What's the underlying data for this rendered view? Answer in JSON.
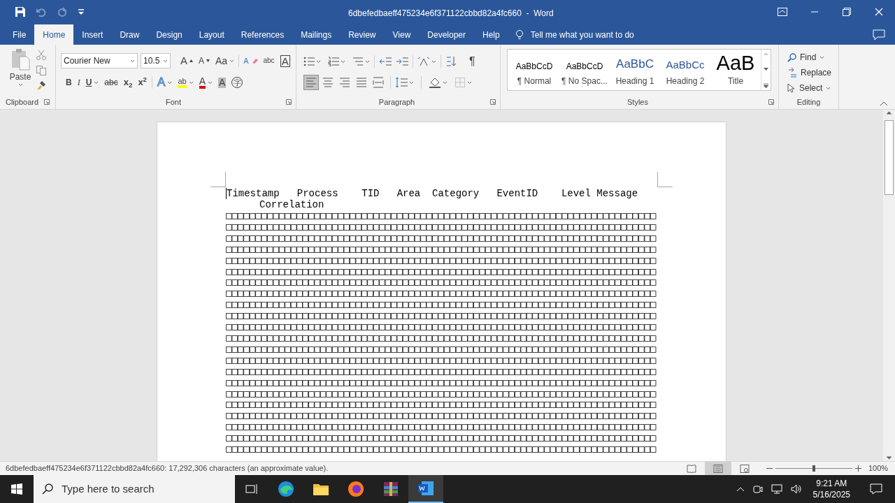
{
  "window": {
    "title": "6dbefedbaeff475234e6f371122cbbd82a4fc660  -  Word"
  },
  "tabs": [
    {
      "label": "File",
      "selected": false
    },
    {
      "label": "Home",
      "selected": true
    },
    {
      "label": "Insert",
      "selected": false
    },
    {
      "label": "Draw",
      "selected": false
    },
    {
      "label": "Design",
      "selected": false
    },
    {
      "label": "Layout",
      "selected": false
    },
    {
      "label": "References",
      "selected": false
    },
    {
      "label": "Mailings",
      "selected": false
    },
    {
      "label": "Review",
      "selected": false
    },
    {
      "label": "View",
      "selected": false
    },
    {
      "label": "Developer",
      "selected": false
    },
    {
      "label": "Help",
      "selected": false
    }
  ],
  "tell_me": {
    "placeholder": "Tell me what you want to do"
  },
  "ribbon": {
    "clipboard": {
      "paste": "Paste",
      "label": "Clipboard"
    },
    "font": {
      "name": "Courier New",
      "size": "10.5",
      "label": "Font",
      "row_1": [
        {
          "kind": "grow",
          "label": "A"
        },
        {
          "kind": "shrink",
          "label": "A"
        },
        {
          "kind": "case",
          "label": "Aa"
        },
        {
          "kind": "clear",
          "label": "A"
        },
        {
          "kind": "phonetic",
          "label": "abc"
        },
        {
          "kind": "border",
          "label": "A"
        }
      ],
      "row_2": [
        {
          "kind": "bold",
          "label": "B"
        },
        {
          "kind": "italic",
          "label": "I"
        },
        {
          "kind": "underline",
          "label": "U"
        },
        {
          "kind": "strike",
          "label": "abc"
        },
        {
          "kind": "sub",
          "label": "x$_{2}$"
        },
        {
          "kind": "sup",
          "label": "x$^{2}$"
        },
        {
          "kind": "effects",
          "label": "A"
        },
        {
          "kind": "highlight",
          "label": "ab"
        },
        {
          "kind": "color",
          "label": "A"
        },
        {
          "kind": "shading",
          "label": "A"
        },
        {
          "kind": "enclose",
          "label": "字"
        }
      ]
    },
    "paragraph": {
      "label": "Paragraph",
      "marks": "¶",
      "alignments": [
        {
          "selected": true
        },
        {
          "selected": false
        },
        {
          "selected": false
        },
        {
          "selected": false
        },
        {
          "selected": false
        }
      ]
    },
    "styles": {
      "label": "Styles",
      "items": [
        {
          "preview": "AaBbCcD",
          "name": "¶ Normal",
          "kind": "body",
          "selected": false
        },
        {
          "preview": "AaBbCcD",
          "name": "¶ No Spac...",
          "kind": "body",
          "selected": false
        },
        {
          "preview": "AaBbC",
          "name": "Heading 1",
          "kind": "heading1",
          "selected": false
        },
        {
          "preview": "AaBbCc",
          "name": "Heading 2",
          "kind": "heading2",
          "selected": false
        },
        {
          "preview": "AaB",
          "name": "Title",
          "kind": "title",
          "selected": false
        }
      ]
    },
    "editing": {
      "label": "Editing",
      "items": [
        {
          "kind": "find",
          "label": "Find"
        },
        {
          "kind": "replace",
          "label": "Replace"
        },
        {
          "kind": "select",
          "label": "Select"
        }
      ]
    }
  },
  "document": {
    "header_lines": [
      "Timestamp   Process    TID   Area  Category   EventID    Level Message",
      "Correlation"
    ],
    "rows": [
      "□□□□□□□□□□□□□□□□□□□□□□□□□□□□□□□□□□□□□□□□□□□□□□□□□□□□□□□□□□□□□□□□□□□□□□□□□",
      "□□□□□□□□□□□□□□□□□□□□□□□□□□□□□□□□□□□□□□□□□□□□□□□□□□□□□□□□□□□□□□□□□□□□□□□□□",
      "□□□□□□□□□□□□□□□□□□□□□□□□□□□□□□□□□□□□□□□□□□□□□□□□□□□□□□□□□□□□□□□□□□□□□□□□□",
      "□□□□□□□□□□□□□□□□□□□□□□□□□□□□□□□□□□□□□□□□□□□□□□□□□□□□□□□□□□□□□□□□□□□□□□□□□",
      "□□□□□□□□□□□□□□□□□□□□□□□□□□□□□□□□□□□□□□□□□□□□□□□□□□□□□□□□□□□□□□□□□□□□□□□□□",
      "□□□□□□□□□□□□□□□□□□□□□□□□□□□□□□□□□□□□□□□□□□□□□□□□□□□□□□□□□□□□□□□□□□□□□□□□□",
      "□□□□□□□□□□□□□□□□□□□□□□□□□□□□□□□□□□□□□□□□□□□□□□□□□□□□□□□□□□□□□□□□□□□□□□□□□",
      "□□□□□□□□□□□□□□□□□□□□□□□□□□□□□□□□□□□□□□□□□□□□□□□□□□□□□□□□□□□□□□□□□□□□□□□□□",
      "□□□□□□□□□□□□□□□□□□□□□□□□□□□□□□□□□□□□□□□□□□□□□□□□□□□□□□□□□□□□□□□□□□□□□□□□□",
      "□□□□□□□□□□□□□□□□□□□□□□□□□□□□□□□□□□□□□□□□□□□□□□□□□□□□□□□□□□□□□□□□□□□□□□□□□",
      "□□□□□□□□□□□□□□□□□□□□□□□□□□□□□□□□□□□□□□□□□□□□□□□□□□□□□□□□□□□□□□□□□□□□□□□□□",
      "□□□□□□□□□□□□□□□□□□□□□□□□□□□□□□□□□□□□□□□□□□□□□□□□□□□□□□□□□□□□□□□□□□□□□□□□□",
      "□□□□□□□□□□□□□□□□□□□□□□□□□□□□□□□□□□□□□□□□□□□□□□□□□□□□□□□□□□□□□□□□□□□□□□□□□",
      "□□□□□□□□□□□□□□□□□□□□□□□□□□□□□□□□□□□□□□□□□□□□□□□□□□□□□□□□□□□□□□□□□□□□□□□□□",
      "□□□□□□□□□□□□□□□□□□□□□□□□□□□□□□□□□□□□□□□□□□□□□□□□□□□□□□□□□□□□□□□□□□□□□□□□□",
      "□□□□□□□□□□□□□□□□□□□□□□□□□□□□□□□□□□□□□□□□□□□□□□□□□□□□□□□□□□□□□□□□□□□□□□□□□",
      "□□□□□□□□□□□□□□□□□□□□□□□□□□□□□□□□□□□□□□□□□□□□□□□□□□□□□□□□□□□□□□□□□□□□□□□□□",
      "□□□□□□□□□□□□□□□□□□□□□□□□□□□□□□□□□□□□□□□□□□□□□□□□□□□□□□□□□□□□□□□□□□□□□□□□□",
      "□□□□□□□□□□□□□□□□□□□□□□□□□□□□□□□□□□□□□□□□□□□□□□□□□□□□□□□□□□□□□□□□□□□□□□□□□",
      "□□□□□□□□□□□□□□□□□□□□□□□□□□□□□□□□□□□□□□□□□□□□□□□□□□□□□□□□□□□□□□□□□□□□□□□□□",
      "□□□□□□□□□□□□□□□□□□□□□□□□□□□□□□□□□□□□□□□□□□□□□□□□□□□□□□□□□□□□□□□□□□□□□□□□□",
      "□□□□□□□□□□□□□□□□□□□□□□□□□□□□□□□□□□□□□□□□□□□□□□□□□□□□□□□□□□□□□□□□□□□□□□□□□"
    ]
  },
  "status_bar": {
    "text": "6dbefedbaeff475234e6f371122cbbd82a4fc660: 17,292,306 characters (an approximate value).",
    "zoom": "100%",
    "level": 0.5
  },
  "taskbar": {
    "search": {
      "placeholder": "Type here to search"
    },
    "time": "9:21 AM",
    "date": "5/16/2025"
  }
}
